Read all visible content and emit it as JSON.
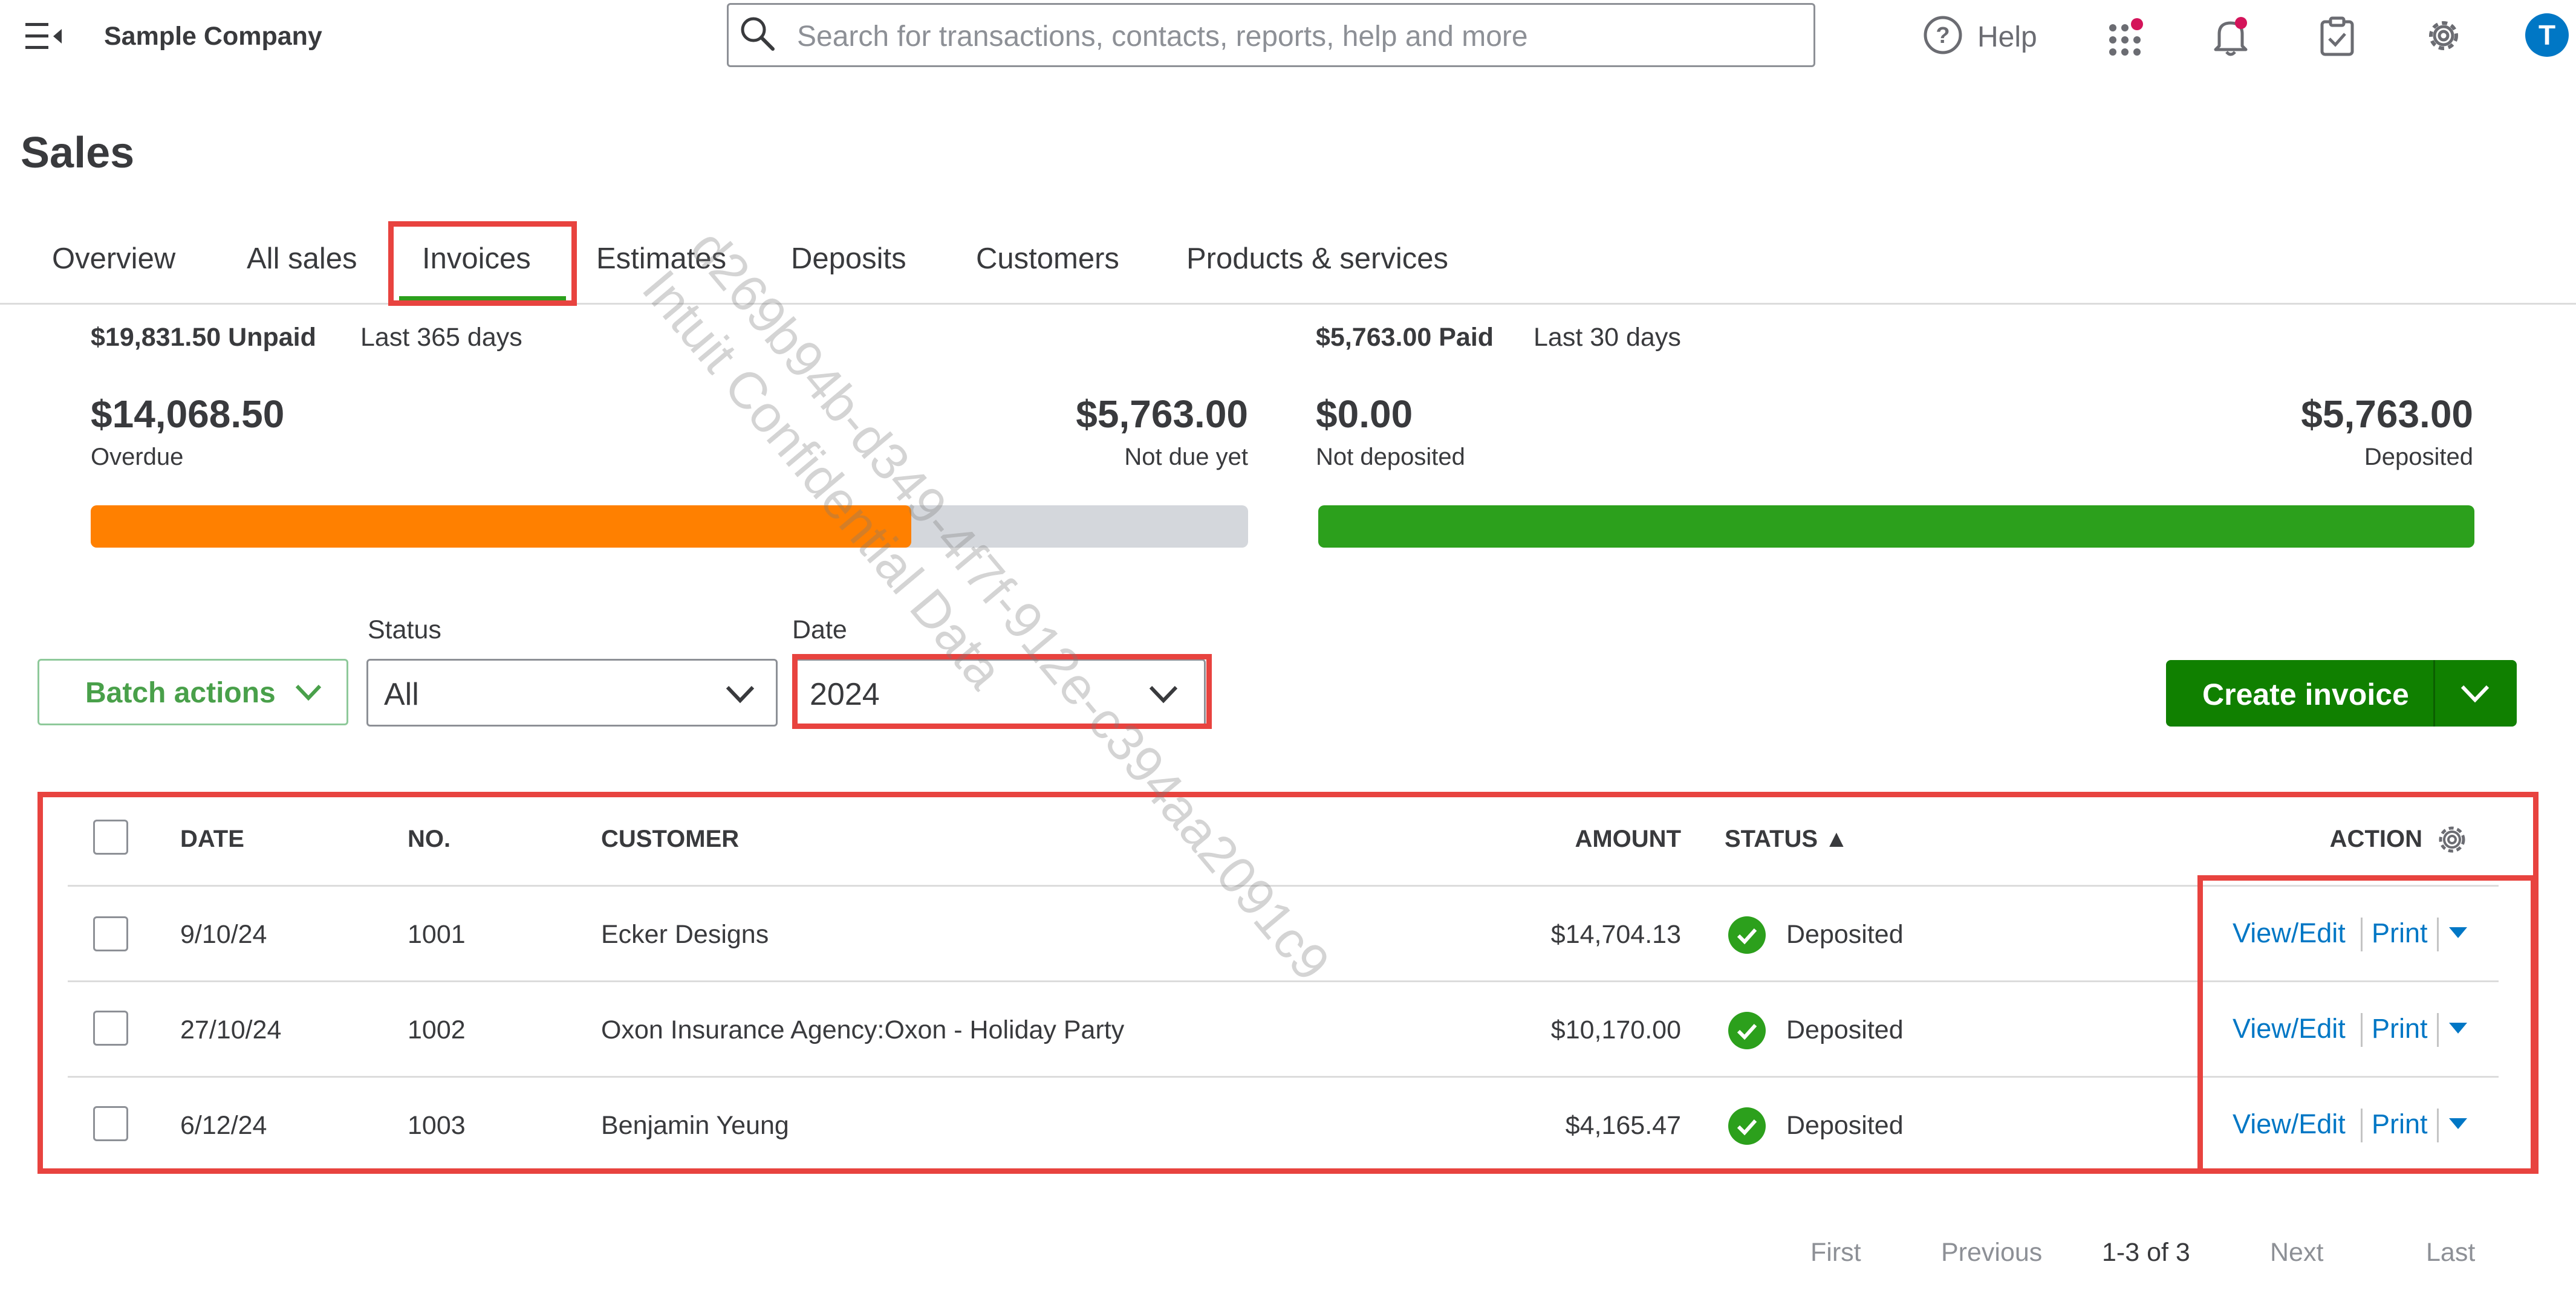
{
  "header": {
    "company": "Sample Company",
    "search_placeholder": "Search for transactions, contacts, reports, help and more",
    "help_label": "Help",
    "avatar_initial": "T"
  },
  "page": {
    "title": "Sales"
  },
  "tabs": [
    {
      "label": "Overview"
    },
    {
      "label": "All sales"
    },
    {
      "label": "Invoices",
      "selected": true
    },
    {
      "label": "Estimates"
    },
    {
      "label": "Deposits"
    },
    {
      "label": "Customers"
    },
    {
      "label": "Products & services"
    }
  ],
  "summary": {
    "unpaid": {
      "title": "$19,831.50 Unpaid",
      "period": "Last 365 days",
      "overdue_amount": "$14,068.50",
      "overdue_label": "Overdue",
      "notdue_amount": "$5,763.00",
      "notdue_label": "Not due yet",
      "overdue_fraction": 0.709
    },
    "paid": {
      "title": "$5,763.00 Paid",
      "period": "Last 30 days",
      "notdeposited_amount": "$0.00",
      "notdeposited_label": "Not deposited",
      "deposited_amount": "$5,763.00",
      "deposited_label": "Deposited",
      "deposited_fraction": 1.0
    }
  },
  "filters": {
    "batch_label": "Batch actions",
    "status_label": "Status",
    "status_value": "All",
    "date_label": "Date",
    "date_value": "2024",
    "create_label": "Create invoice"
  },
  "table": {
    "headers": {
      "date": "DATE",
      "no": "NO.",
      "customer": "CUSTOMER",
      "amount": "AMOUNT",
      "status": "STATUS ▲",
      "action": "ACTION"
    },
    "rows": [
      {
        "date": "9/10/24",
        "no": "1001",
        "customer": "Ecker Designs",
        "amount": "$14,704.13",
        "status": "Deposited",
        "view": "View/Edit",
        "print": "Print"
      },
      {
        "date": "27/10/24",
        "no": "1002",
        "customer": "Oxon Insurance Agency:Oxon - Holiday Party",
        "amount": "$10,170.00",
        "status": "Deposited",
        "view": "View/Edit",
        "print": "Print"
      },
      {
        "date": "6/12/24",
        "no": "1003",
        "customer": "Benjamin Yeung",
        "amount": "$4,165.47",
        "status": "Deposited",
        "view": "View/Edit",
        "print": "Print"
      }
    ]
  },
  "pagination": {
    "first": "First",
    "previous": "Previous",
    "range": "1-3 of 3",
    "next": "Next",
    "last": "Last"
  },
  "watermark": {
    "line1": "d269b94b-d349-4f7f-912e-c394aa2091c9",
    "line2": "Intuit Confidential Data"
  },
  "colors": {
    "overdue": "#ff8000",
    "not_due": "#d4d7dc",
    "deposited": "#2ca01c",
    "accent_green": "#108000",
    "link": "#0077c5",
    "highlight": "#e8433f"
  }
}
